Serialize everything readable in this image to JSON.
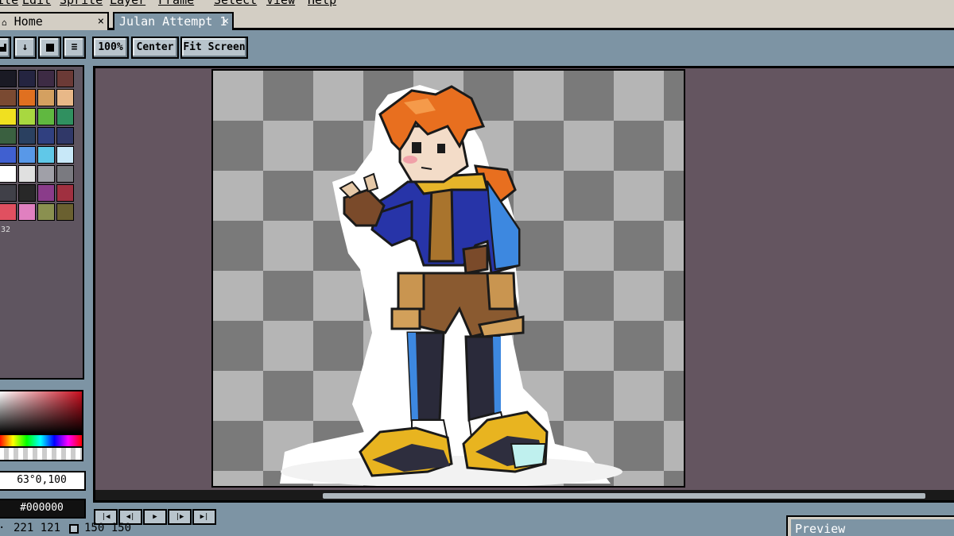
{
  "menu": {
    "items": [
      "File",
      "Edit",
      "Sprite",
      "Layer",
      "Frame",
      "Select",
      "View",
      "Help"
    ]
  },
  "tabs": [
    {
      "label": "Home",
      "icon": "home-icon",
      "close": "×"
    },
    {
      "label": "Julan Attempt 1",
      "close": "×"
    }
  ],
  "toolbar": {
    "zoom_label": "100%",
    "center_label": "Center",
    "fit_label": "Fit Screen",
    "icons": [
      "save-icon",
      "import-icon",
      "layer-icon",
      "menu-icon"
    ]
  },
  "palette": {
    "colors": [
      "#1a1a24",
      "#242440",
      "#3d2b44",
      "#6b3a36",
      "#7a4a32",
      "#e07020",
      "#d4a060",
      "#e8b888",
      "#f0e020",
      "#a8d840",
      "#60b840",
      "#309060",
      "#3a6040",
      "#2a4060",
      "#304080",
      "#303868",
      "#4060d0",
      "#5898e8",
      "#60c8e8",
      "#c8e8f8",
      "#ffffff",
      "#e0e0e0",
      "#a0a0a8",
      "#7a7a80",
      "#404048",
      "#282828",
      "#8a3c8a",
      "#a03040",
      "#e05060",
      "#e080c0",
      "#8a9050",
      "#6a6030"
    ],
    "count": "32"
  },
  "color_picker": {
    "hsv": "63°0,100",
    "hex": "#000000",
    "base_color": "#c80d1d"
  },
  "timeline": {
    "controls": [
      "|◀",
      "◀|",
      "▶",
      "|▶",
      "▶|"
    ]
  },
  "status": {
    "cursor_pos": "221 121",
    "sprite_size": "150 150"
  },
  "preview": {
    "title": "Preview"
  }
}
